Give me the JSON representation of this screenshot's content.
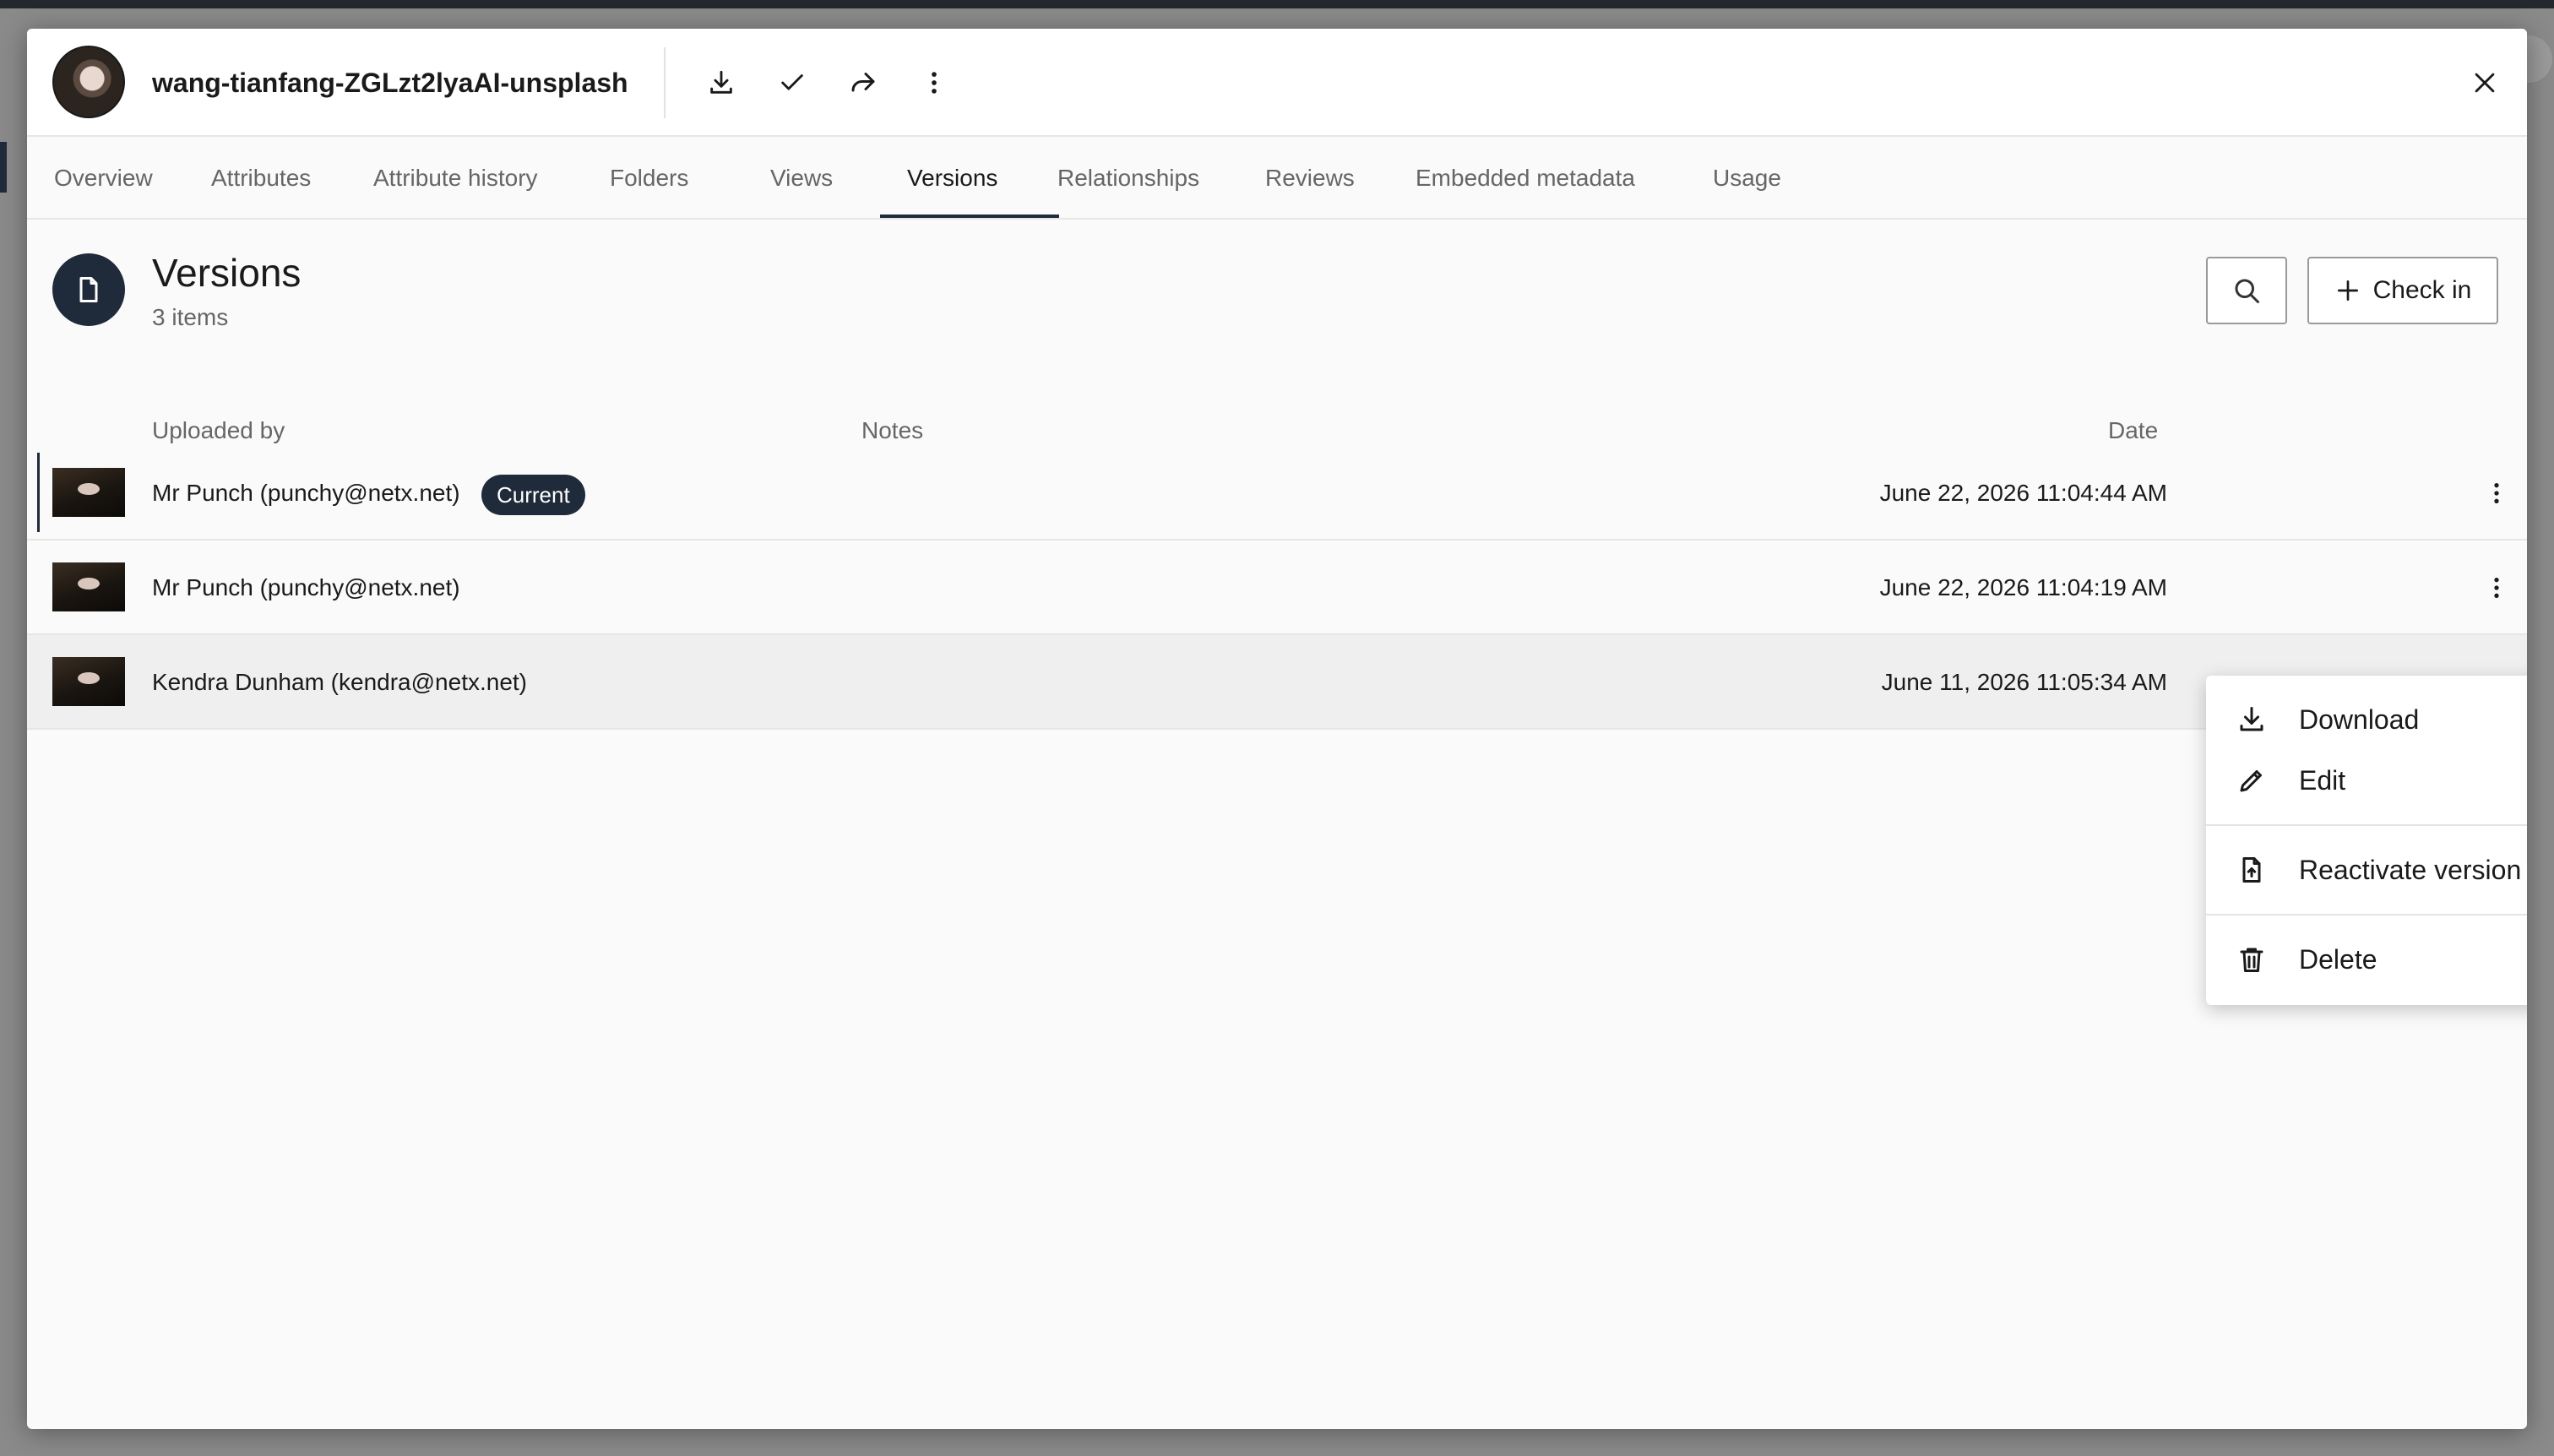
{
  "dialog": {
    "title": "wang-tianfang-ZGLzt2lyaAI-unsplash",
    "header_icons": [
      "download-icon",
      "checkmark-icon",
      "share-icon",
      "more-vertical-icon",
      "close-icon"
    ]
  },
  "tabs": [
    {
      "label": "Overview"
    },
    {
      "label": "Attributes"
    },
    {
      "label": "Attribute history"
    },
    {
      "label": "Folders"
    },
    {
      "label": "Views"
    },
    {
      "label": "Versions",
      "active": true
    },
    {
      "label": "Relationships"
    },
    {
      "label": "Reviews"
    },
    {
      "label": "Embedded metadata"
    },
    {
      "label": "Usage"
    }
  ],
  "section": {
    "title": "Versions",
    "count": "3 items",
    "icon": "document-icon",
    "check_in_label": "Check in"
  },
  "table": {
    "columns": [
      "Uploaded by",
      "Notes",
      "Date"
    ],
    "rows": [
      {
        "uploaded_by": "Mr Punch (punchy@netx.net)",
        "badge": "Current",
        "notes": "",
        "date": "June 22, 2026 11:04:44 AM"
      },
      {
        "uploaded_by": "Mr Punch (punchy@netx.net)",
        "notes": "",
        "date": "June 22, 2026 11:04:19 AM"
      },
      {
        "uploaded_by": "Kendra Dunham (kendra@netx.net)",
        "notes": "",
        "date": "June 11, 2026 11:05:34 AM"
      }
    ]
  },
  "context_menu": {
    "items": [
      {
        "label": "Download",
        "icon": "download-icon"
      },
      {
        "label": "Edit",
        "icon": "pencil-icon"
      },
      {
        "label": "Reactivate version",
        "icon": "file-upload-icon"
      },
      {
        "label": "Delete",
        "icon": "trash-icon"
      }
    ]
  },
  "colors": {
    "accent": "#1f2a3a",
    "background": "#fafafa"
  }
}
